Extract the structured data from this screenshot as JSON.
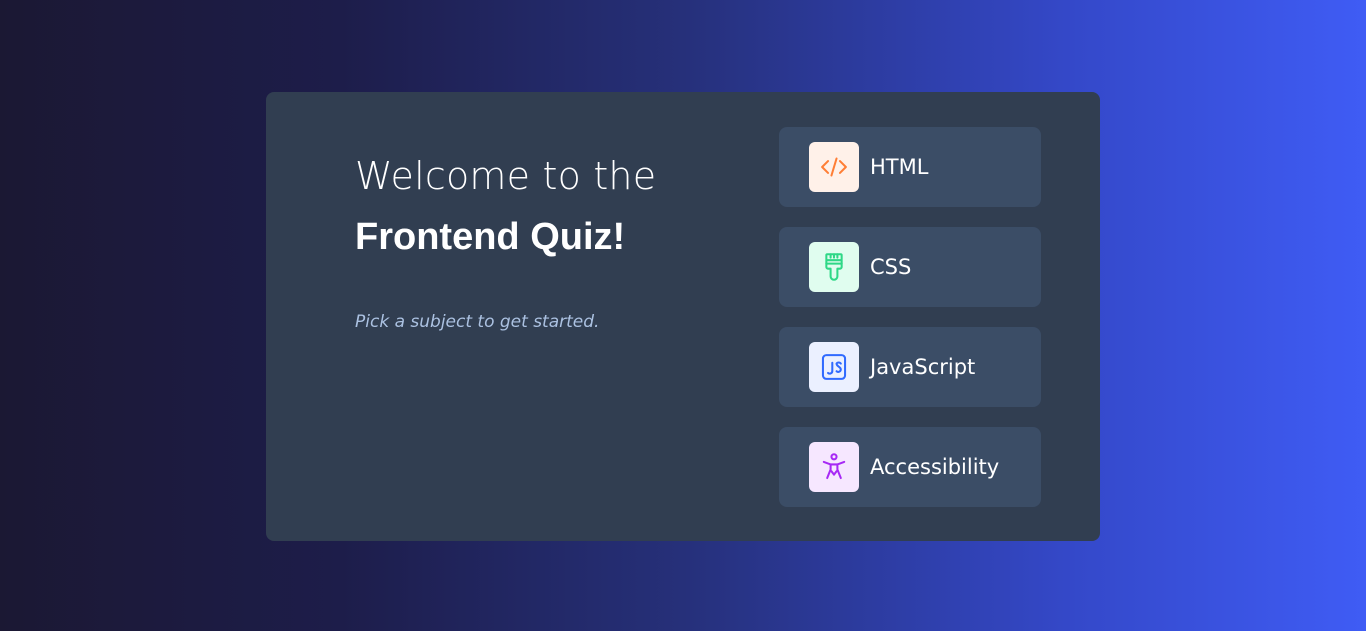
{
  "welcome": {
    "line1": "Welcome to the",
    "line2": "Frontend Quiz!",
    "subtitle": "Pick a subject to get started."
  },
  "subjects": [
    {
      "label": "HTML",
      "icon": "html-code-icon",
      "icon_bg": "#fff1e9",
      "icon_color": "#ff7e35"
    },
    {
      "label": "CSS",
      "icon": "css-brush-icon",
      "icon_bg": "#e0fdef",
      "icon_color": "#2fd887"
    },
    {
      "label": "JavaScript",
      "icon": "javascript-js-icon",
      "icon_bg": "#ebf0ff",
      "icon_color": "#306aff"
    },
    {
      "label": "Accessibility",
      "icon": "accessibility-person-icon",
      "icon_bg": "#f6e7ff",
      "icon_color": "#a729f5"
    }
  ],
  "colors": {
    "card_bg": "#313e51",
    "button_bg": "#3b4d66",
    "subtitle": "#abc1e1",
    "text": "#ffffff"
  }
}
